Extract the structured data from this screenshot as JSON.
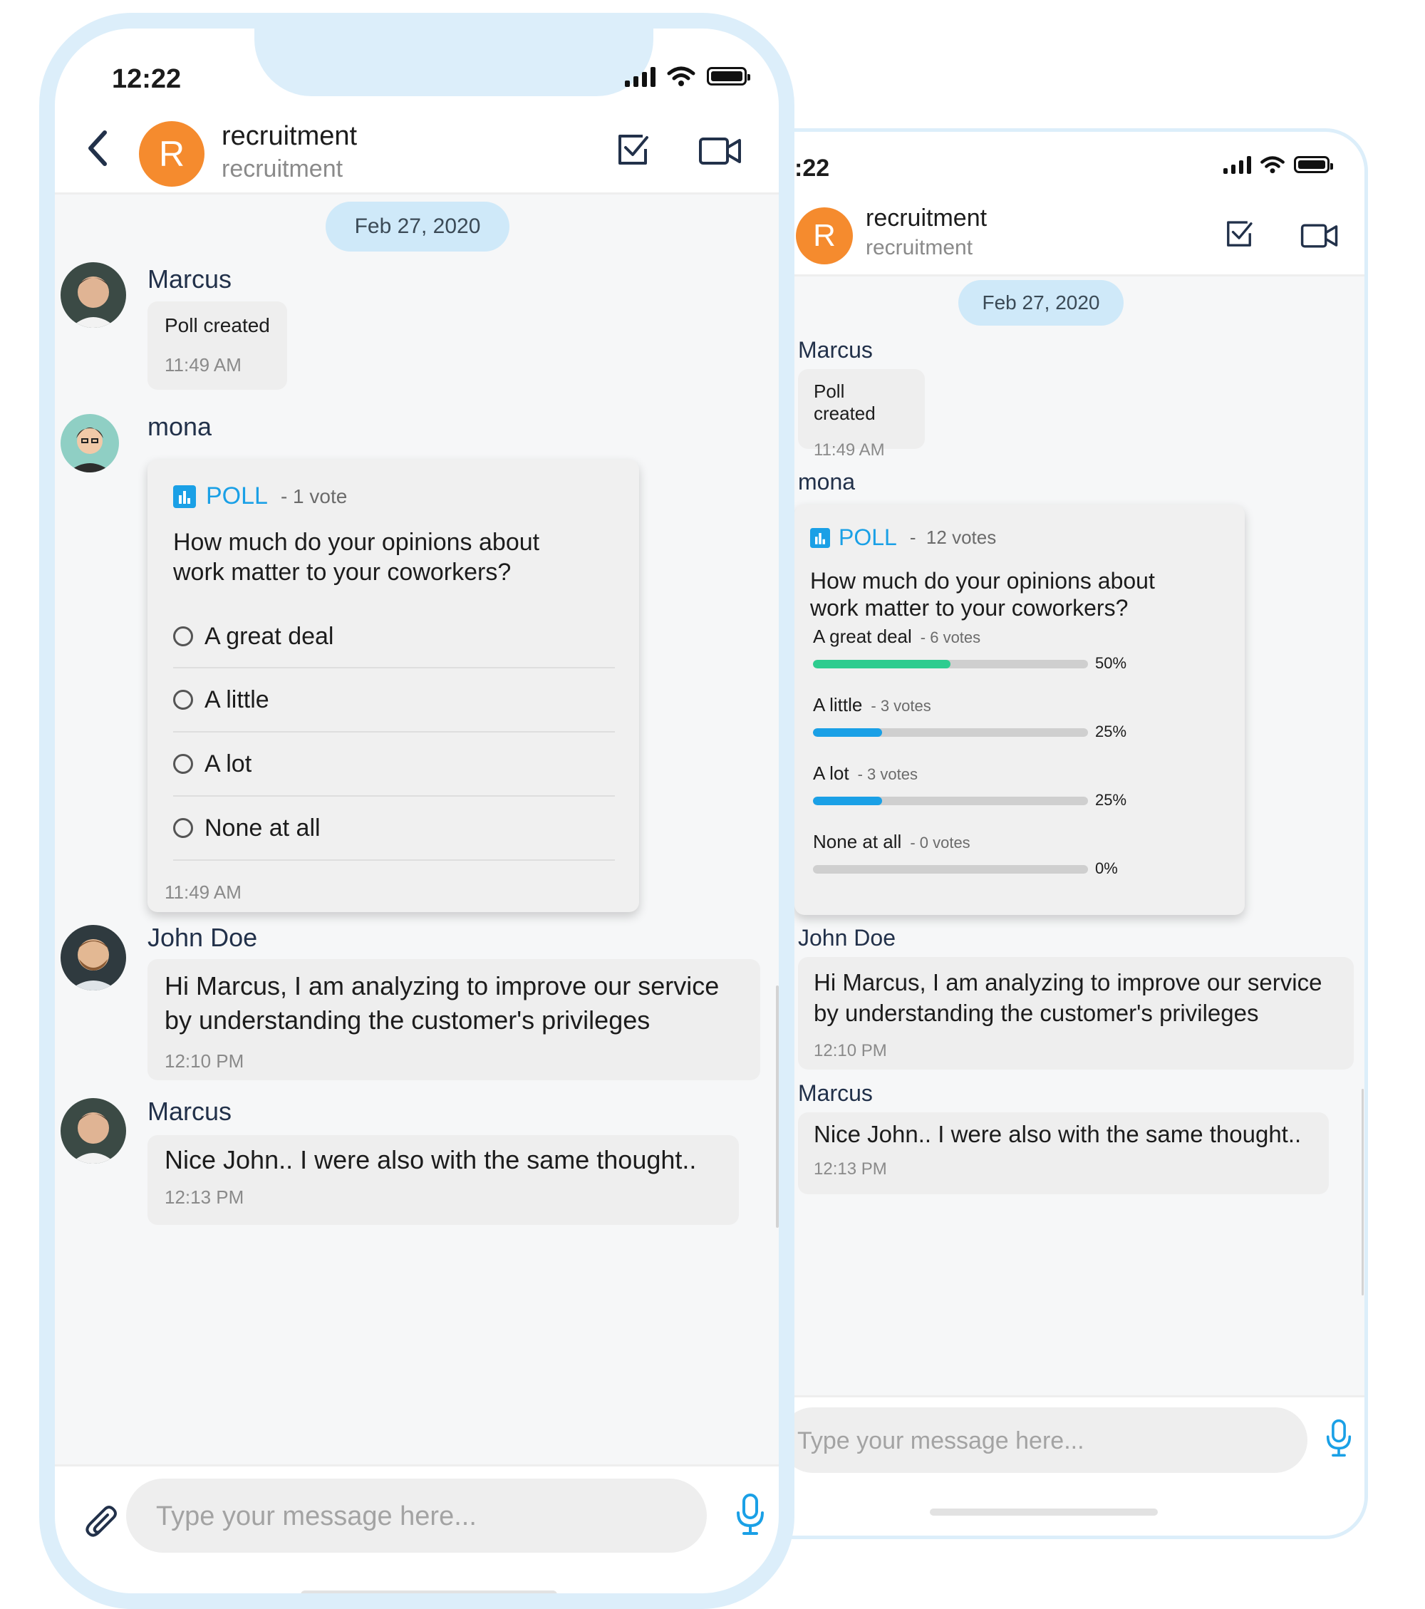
{
  "status": {
    "time_left": "12:22",
    "time_right": ":22"
  },
  "header": {
    "avatar_letter": "R",
    "title": "recruitment",
    "subtitle": "recruitment"
  },
  "chat": {
    "date": "Feb 27, 2020",
    "messages": [
      {
        "sender": "Marcus",
        "text": "Poll created",
        "time": "11:49 AM"
      },
      {
        "sender": "mona"
      },
      {
        "sender": "John Doe",
        "text": "Hi Marcus, I am analyzing to improve our service by understanding the customer's privileges",
        "time": "12:10 PM"
      },
      {
        "sender": "Marcus",
        "text": "Nice John.. I were also with the same thought..",
        "time": "12:13 PM"
      }
    ]
  },
  "poll_left": {
    "label": "POLL",
    "votes": "- 1 vote",
    "question": "How much do your opinions about work matter to your coworkers?",
    "options": [
      "A great deal",
      "A little",
      "A lot",
      "None at all"
    ],
    "time": "11:49 AM"
  },
  "poll_right": {
    "label": "POLL",
    "votes": "-  12 votes",
    "question": "How much do your opinions about work matter to your coworkers?",
    "results": [
      {
        "label": "A great deal",
        "votes": "- 6 votes",
        "percent_text": "50%",
        "fraction": 0.5,
        "color": "#2ecc8f"
      },
      {
        "label": "A little",
        "votes": "- 3 votes",
        "percent_text": "25%",
        "fraction": 0.25,
        "color": "#1aa0e6"
      },
      {
        "label": "A lot",
        "votes": "- 3 votes",
        "percent_text": "25%",
        "fraction": 0.25,
        "color": "#1aa0e6"
      },
      {
        "label": "None at all",
        "votes": "- 0 votes",
        "percent_text": "0%",
        "fraction": 0,
        "color": "#1aa0e6"
      }
    ]
  },
  "composer": {
    "placeholder": "Type your message here..."
  },
  "colors": {
    "accent": "#1aa0e6",
    "avatar": "#f58b2e",
    "frame": "#dceefa",
    "date_pill": "#cfe9f9"
  },
  "icons": [
    "back-arrow-icon",
    "checkbox-icon",
    "video-camera-icon",
    "poll-icon",
    "paperclip-icon",
    "microphone-icon",
    "signal-icon",
    "wifi-icon",
    "battery-icon"
  ]
}
